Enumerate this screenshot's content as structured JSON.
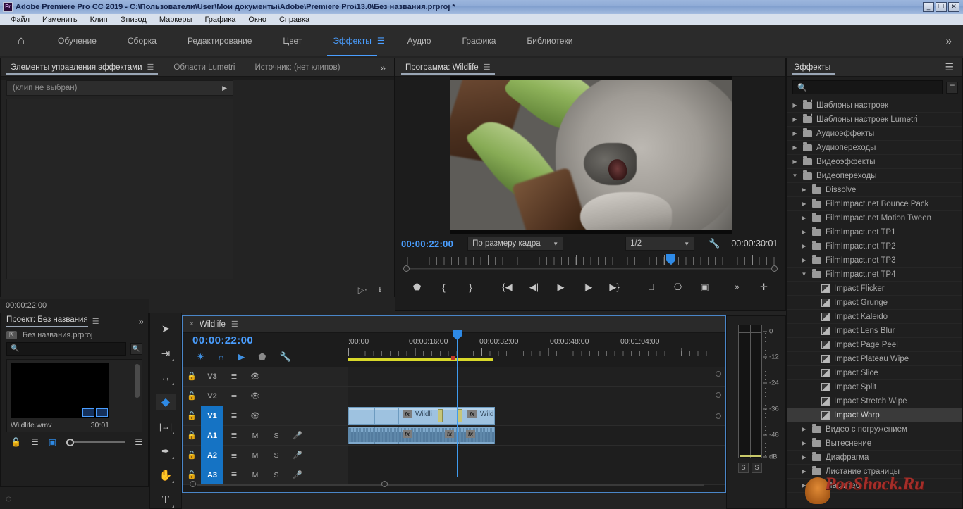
{
  "window": {
    "title": "Adobe Premiere Pro CC 2019 - C:\\Пользователи\\User\\Мои документы\\Adobe\\Premiere Pro\\13.0\\Без названия.prproj *",
    "app_badge": "Pr",
    "minimize": "_",
    "maximize": "❐",
    "close": "✕"
  },
  "menu": {
    "items": [
      "Файл",
      "Изменить",
      "Клип",
      "Эпизод",
      "Маркеры",
      "Графика",
      "Окно",
      "Справка"
    ]
  },
  "workspace": {
    "home_icon": "home-icon",
    "items": [
      {
        "label": "Обучение",
        "active": false
      },
      {
        "label": "Сборка",
        "active": false
      },
      {
        "label": "Редактирование",
        "active": false
      },
      {
        "label": "Цвет",
        "active": false
      },
      {
        "label": "Эффекты",
        "active": true
      },
      {
        "label": "Аудио",
        "active": false
      },
      {
        "label": "Графика",
        "active": false
      },
      {
        "label": "Библиотеки",
        "active": false
      }
    ],
    "overflow": "»"
  },
  "effect_controls": {
    "tabs": [
      {
        "label": "Элементы управления эффектами",
        "active": true,
        "has_burger": true
      },
      {
        "label": "Области Lumetri",
        "active": false,
        "has_burger": false
      },
      {
        "label": "Источник: (нет клипов)",
        "active": false,
        "has_burger": false
      }
    ],
    "overflow": "»",
    "no_clip_label": "(клип не выбран)",
    "timecode": "00:00:22:00"
  },
  "program_monitor": {
    "tab_label": "Программа: Wildlife",
    "current_timecode": "00:00:22:00",
    "fit_label": "По размеру кадра",
    "quality_label": "1/2",
    "duration_timecode": "00:00:30:01",
    "settings_icon": "wrench-icon",
    "transport": [
      {
        "name": "add-marker-button",
        "glyph": "⬟"
      },
      {
        "name": "mark-in-button",
        "glyph": "{"
      },
      {
        "name": "mark-out-button",
        "glyph": "}"
      },
      {
        "name": "go-to-in-button",
        "glyph": "{◀"
      },
      {
        "name": "step-back-button",
        "glyph": "◀|"
      },
      {
        "name": "play-stop-button",
        "glyph": "▶"
      },
      {
        "name": "step-forward-button",
        "glyph": "|▶"
      },
      {
        "name": "go-to-out-button",
        "glyph": "▶}"
      },
      {
        "name": "lift-button",
        "glyph": "⎕"
      },
      {
        "name": "extract-button",
        "glyph": "⎔"
      },
      {
        "name": "export-frame-button",
        "glyph": "▣"
      },
      {
        "name": "button-editor-more",
        "glyph": "»"
      },
      {
        "name": "add-button-plus",
        "glyph": "✛"
      }
    ]
  },
  "effects_panel": {
    "tab_label": "Эффекты",
    "burger": "☰",
    "search_placeholder": "",
    "search_value": "",
    "new_bin_icon": "new-custom-bin-icon",
    "rows": [
      {
        "label": "Шаблоны настроек",
        "indent": 0,
        "icon": "preset-folder-icon",
        "twisty": "collapsed",
        "selected": false
      },
      {
        "label": "Шаблоны настроек Lumetri",
        "indent": 0,
        "icon": "preset-folder-icon",
        "twisty": "collapsed",
        "selected": false
      },
      {
        "label": "Аудиоэффекты",
        "indent": 0,
        "icon": "folder-icon",
        "twisty": "collapsed",
        "selected": false
      },
      {
        "label": "Аудиопереходы",
        "indent": 0,
        "icon": "folder-icon",
        "twisty": "collapsed",
        "selected": false
      },
      {
        "label": "Видеоэффекты",
        "indent": 0,
        "icon": "folder-icon",
        "twisty": "collapsed",
        "selected": false
      },
      {
        "label": "Видеопереходы",
        "indent": 0,
        "icon": "folder-icon",
        "twisty": "expanded",
        "selected": false
      },
      {
        "label": "Dissolve",
        "indent": 1,
        "icon": "folder-icon",
        "twisty": "collapsed",
        "selected": false
      },
      {
        "label": "FilmImpact.net Bounce Pack",
        "indent": 1,
        "icon": "folder-icon",
        "twisty": "collapsed",
        "selected": false
      },
      {
        "label": "FilmImpact.net Motion Tween",
        "indent": 1,
        "icon": "folder-icon",
        "twisty": "collapsed",
        "selected": false
      },
      {
        "label": "FilmImpact.net TP1",
        "indent": 1,
        "icon": "folder-icon",
        "twisty": "collapsed",
        "selected": false
      },
      {
        "label": "FilmImpact.net TP2",
        "indent": 1,
        "icon": "folder-icon",
        "twisty": "collapsed",
        "selected": false
      },
      {
        "label": "FilmImpact.net TP3",
        "indent": 1,
        "icon": "folder-icon",
        "twisty": "collapsed",
        "selected": false
      },
      {
        "label": "FilmImpact.net TP4",
        "indent": 1,
        "icon": "folder-icon",
        "twisty": "expanded",
        "selected": false
      },
      {
        "label": "Impact Flicker",
        "indent": 2,
        "icon": "transition-icon",
        "twisty": "none",
        "selected": false
      },
      {
        "label": "Impact Grunge",
        "indent": 2,
        "icon": "transition-icon",
        "twisty": "none",
        "selected": false
      },
      {
        "label": "Impact Kaleido",
        "indent": 2,
        "icon": "transition-icon",
        "twisty": "none",
        "selected": false
      },
      {
        "label": "Impact Lens Blur",
        "indent": 2,
        "icon": "transition-icon",
        "twisty": "none",
        "selected": false
      },
      {
        "label": "Impact Page Peel",
        "indent": 2,
        "icon": "transition-icon",
        "twisty": "none",
        "selected": false
      },
      {
        "label": "Impact Plateau Wipe",
        "indent": 2,
        "icon": "transition-icon",
        "twisty": "none",
        "selected": false
      },
      {
        "label": "Impact Slice",
        "indent": 2,
        "icon": "transition-icon",
        "twisty": "none",
        "selected": false
      },
      {
        "label": "Impact Split",
        "indent": 2,
        "icon": "transition-icon",
        "twisty": "none",
        "selected": false
      },
      {
        "label": "Impact Stretch Wipe",
        "indent": 2,
        "icon": "transition-icon",
        "twisty": "none",
        "selected": false
      },
      {
        "label": "Impact Warp",
        "indent": 2,
        "icon": "transition-icon",
        "twisty": "none",
        "selected": true
      },
      {
        "label": "Видео с погружением",
        "indent": 1,
        "icon": "folder-icon",
        "twisty": "collapsed",
        "selected": false
      },
      {
        "label": "Вытеснение",
        "indent": 1,
        "icon": "folder-icon",
        "twisty": "collapsed",
        "selected": false
      },
      {
        "label": "Диафрагма",
        "indent": 1,
        "icon": "folder-icon",
        "twisty": "collapsed",
        "selected": false
      },
      {
        "label": "Листание страницы",
        "indent": 1,
        "icon": "folder-icon",
        "twisty": "collapsed",
        "selected": false
      },
      {
        "label": "Масштаб",
        "indent": 1,
        "icon": "folder-icon",
        "twisty": "collapsed",
        "selected": false
      }
    ]
  },
  "project_panel": {
    "tab_label": "Проект: Без названия",
    "burger": "☰",
    "overflow": "»",
    "project_file": "Без названия.prproj",
    "search_value": "",
    "search_placeholder": "",
    "item": {
      "name": "Wildlife.wmv",
      "duration": "30:01"
    },
    "footer_icons": [
      "lock-icon",
      "list-view-icon",
      "icon-view-icon",
      "zoom-slider",
      "options-burger"
    ]
  },
  "tools": [
    {
      "name": "selection-tool",
      "glyph": "➤",
      "active": false
    },
    {
      "name": "track-select-forward-tool",
      "glyph": "⇥",
      "active": false
    },
    {
      "name": "ripple-edit-tool",
      "glyph": "↔",
      "active": false
    },
    {
      "name": "razor-tool",
      "glyph": "◆",
      "active": true
    },
    {
      "name": "slip-tool",
      "glyph": "|↔|",
      "active": false
    },
    {
      "name": "pen-tool",
      "glyph": "✒",
      "active": false
    },
    {
      "name": "hand-tool",
      "glyph": "✋",
      "active": false
    },
    {
      "name": "type-tool",
      "glyph": "T",
      "active": false
    }
  ],
  "timeline": {
    "close_icon": "×",
    "sequence_name": "Wildlife",
    "burger": "☰",
    "playhead_timecode": "00:00:22:00",
    "header_tools": [
      {
        "name": "sequence-settings-icon",
        "glyph": "✳",
        "on": true
      },
      {
        "name": "snap-toggle-icon",
        "glyph": "∩",
        "on": true
      },
      {
        "name": "linked-selection-icon",
        "glyph": "▶",
        "on": true
      },
      {
        "name": "add-marker-icon",
        "glyph": "⬟",
        "on": false
      },
      {
        "name": "timeline-display-settings-icon",
        "glyph": "🔧",
        "on": false
      }
    ],
    "ruler_labels": [
      ":00:00",
      "00:00:16:00",
      "00:00:32:00",
      "00:00:48:00",
      "00:01:04:00"
    ],
    "tracks": [
      {
        "name": "V3",
        "type": "video",
        "targeted": false,
        "lock": "🔓",
        "sync": "⇶",
        "eye": "👁"
      },
      {
        "name": "V2",
        "type": "video",
        "targeted": false,
        "lock": "🔓",
        "sync": "⇶",
        "eye": "👁"
      },
      {
        "name": "V1",
        "type": "video",
        "targeted": true,
        "lock": "🔓",
        "sync": "⇶",
        "eye": "👁"
      },
      {
        "name": "A1",
        "type": "audio",
        "targeted": true,
        "lock": "🔓",
        "sync": "⇶",
        "mute": "M",
        "solo": "S",
        "mic": "🎤"
      },
      {
        "name": "A2",
        "type": "audio",
        "targeted": true,
        "lock": "🔓",
        "sync": "⇶",
        "mute": "M",
        "solo": "S",
        "mic": "🎤"
      },
      {
        "name": "A3",
        "type": "audio",
        "targeted": true,
        "lock": "🔓",
        "sync": "⇶",
        "mute": "M",
        "solo": "S",
        "mic": "🎤"
      }
    ],
    "video_clip_labels": [
      "Wildli",
      "Wildli"
    ],
    "fx_badge": "fx"
  },
  "audio_meter": {
    "scale_labels": [
      "0",
      "-12",
      "-24",
      "-36",
      "-48",
      "dB"
    ],
    "solo_buttons": [
      "S",
      "S"
    ]
  },
  "watermark": {
    "text": "PooShock.Ru"
  },
  "colors": {
    "accent_blue": "#4a9eff",
    "track_target_blue": "#1573c4",
    "workbar_yellow": "#d8d82a",
    "clip_blue": "#9ec2e0",
    "panel_bg": "#1f1f1f",
    "titlebar_blue": "#8fabd6"
  }
}
